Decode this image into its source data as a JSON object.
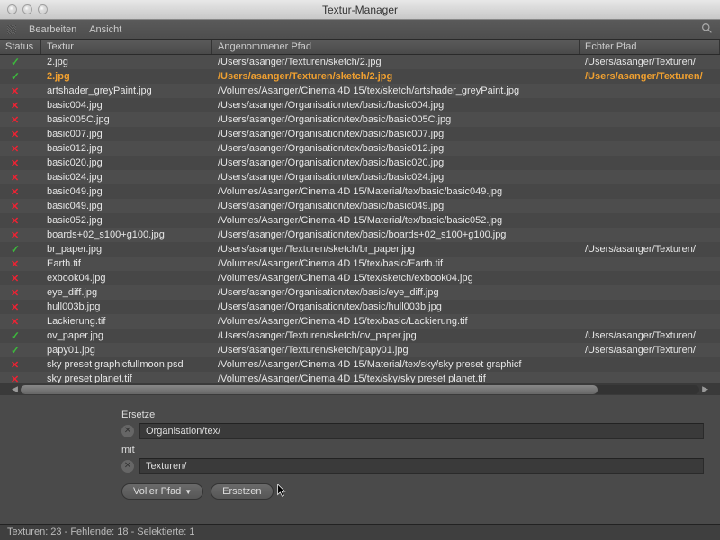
{
  "window": {
    "title": "Textur-Manager"
  },
  "menu": {
    "edit": "Bearbeiten",
    "view": "Ansicht"
  },
  "columns": {
    "status": "Status",
    "texture": "Textur",
    "assumed": "Angenommener Pfad",
    "real": "Echter Pfad"
  },
  "rows": [
    {
      "status": "ok",
      "texture": "2.jpg",
      "assumed": "/Users/asanger/Texturen/sketch/2.jpg",
      "real": "/Users/asanger/Texturen/",
      "selected": false
    },
    {
      "status": "ok",
      "texture": "2.jpg",
      "assumed": "/Users/asanger/Texturen/sketch/2.jpg",
      "real": "/Users/asanger/Texturen/",
      "selected": true
    },
    {
      "status": "err",
      "texture": "artshader_greyPaint.jpg",
      "assumed": "/Volumes/Asanger/Cinema 4D 15/tex/sketch/artshader_greyPaint.jpg",
      "real": ""
    },
    {
      "status": "err",
      "texture": "basic004.jpg",
      "assumed": "/Users/asanger/Organisation/tex/basic/basic004.jpg",
      "real": ""
    },
    {
      "status": "err",
      "texture": "basic005C.jpg",
      "assumed": "/Users/asanger/Organisation/tex/basic/basic005C.jpg",
      "real": ""
    },
    {
      "status": "err",
      "texture": "basic007.jpg",
      "assumed": "/Users/asanger/Organisation/tex/basic/basic007.jpg",
      "real": ""
    },
    {
      "status": "err",
      "texture": "basic012.jpg",
      "assumed": "/Users/asanger/Organisation/tex/basic/basic012.jpg",
      "real": ""
    },
    {
      "status": "err",
      "texture": "basic020.jpg",
      "assumed": "/Users/asanger/Organisation/tex/basic/basic020.jpg",
      "real": ""
    },
    {
      "status": "err",
      "texture": "basic024.jpg",
      "assumed": "/Users/asanger/Organisation/tex/basic/basic024.jpg",
      "real": ""
    },
    {
      "status": "err",
      "texture": "basic049.jpg",
      "assumed": "/Volumes/Asanger/Cinema 4D 15/Material/tex/basic/basic049.jpg",
      "real": ""
    },
    {
      "status": "err",
      "texture": "basic049.jpg",
      "assumed": "/Users/asanger/Organisation/tex/basic/basic049.jpg",
      "real": ""
    },
    {
      "status": "err",
      "texture": "basic052.jpg",
      "assumed": "/Volumes/Asanger/Cinema 4D 15/Material/tex/basic/basic052.jpg",
      "real": ""
    },
    {
      "status": "err",
      "texture": "boards+02_s100+g100.jpg",
      "assumed": "/Users/asanger/Organisation/tex/basic/boards+02_s100+g100.jpg",
      "real": ""
    },
    {
      "status": "ok",
      "texture": "br_paper.jpg",
      "assumed": "/Users/asanger/Texturen/sketch/br_paper.jpg",
      "real": "/Users/asanger/Texturen/"
    },
    {
      "status": "err",
      "texture": "Earth.tif",
      "assumed": "/Volumes/Asanger/Cinema 4D 15/tex/basic/Earth.tif",
      "real": ""
    },
    {
      "status": "err",
      "texture": "exbook04.jpg",
      "assumed": "/Volumes/Asanger/Cinema 4D 15/tex/sketch/exbook04.jpg",
      "real": ""
    },
    {
      "status": "err",
      "texture": "eye_diff.jpg",
      "assumed": "/Users/asanger/Organisation/tex/basic/eye_diff.jpg",
      "real": ""
    },
    {
      "status": "err",
      "texture": "hull003b.jpg",
      "assumed": "/Users/asanger/Organisation/tex/basic/hull003b.jpg",
      "real": ""
    },
    {
      "status": "err",
      "texture": "Lackierung.tif",
      "assumed": "/Volumes/Asanger/Cinema 4D 15/tex/basic/Lackierung.tif",
      "real": ""
    },
    {
      "status": "ok",
      "texture": "ov_paper.jpg",
      "assumed": "/Users/asanger/Texturen/sketch/ov_paper.jpg",
      "real": "/Users/asanger/Texturen/"
    },
    {
      "status": "ok",
      "texture": "papy01.jpg",
      "assumed": "/Users/asanger/Texturen/sketch/papy01.jpg",
      "real": "/Users/asanger/Texturen/"
    },
    {
      "status": "err",
      "texture": "sky preset graphicfullmoon.psd",
      "assumed": "/Volumes/Asanger/Cinema 4D 15/Material/tex/sky/sky preset graphicf",
      "real": ""
    },
    {
      "status": "err",
      "texture": "sky preset planet.tif",
      "assumed": "/Volumes/Asanger/Cinema 4D 15/tex/sky/sky preset planet.tif",
      "real": ""
    }
  ],
  "form": {
    "replace_label": "Ersetze",
    "with_label": "mit",
    "search_value": "Organisation/tex/",
    "replace_value": "Texturen/",
    "mode_label": "Voller Pfad",
    "replace_button": "Ersetzen"
  },
  "statusbar": "Texturen: 23 - Fehlende: 18 - Selektierte: 1"
}
